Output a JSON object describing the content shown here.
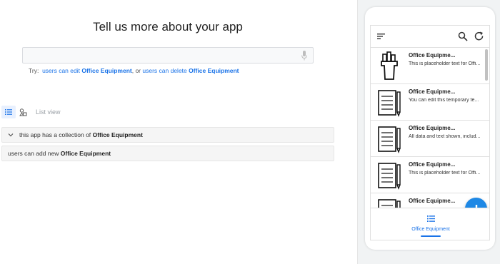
{
  "builder": {
    "heading": "Tell us more about your app",
    "input_value": "",
    "try": {
      "prefix": "Try:",
      "s1_text": "users can edit",
      "s1_entity": "Office Equipment",
      "sep": ", or",
      "s2_text": "users can delete",
      "s2_entity": "Office Equipment"
    },
    "view_label": "List view",
    "statements": [
      {
        "text": "this app has a collection of",
        "entity": "Office Equipment"
      },
      {
        "text": "users can add new",
        "entity": "Office Equipment"
      }
    ]
  },
  "preview": {
    "items": [
      {
        "title": "Office Equipme...",
        "desc": "This is placeholder text for Offi..."
      },
      {
        "title": "Office Equipme...",
        "desc": "You can edit this temporary te..."
      },
      {
        "title": "Office Equipme...",
        "desc": "All data and text shown, includ..."
      },
      {
        "title": "Office Equipme...",
        "desc": "This is placeholder text for Offi..."
      },
      {
        "title": "Office Equipme...",
        "desc": ""
      }
    ],
    "nav_label": "Office Equipment"
  },
  "colors": {
    "accent": "#1a73e8",
    "fab": "#1e88e5"
  },
  "icons": [
    "mic-icon",
    "list-view-icon",
    "component-view-icon",
    "chevron-down-icon",
    "menu-icon",
    "search-icon",
    "refresh-icon",
    "add-icon",
    "nav-list-icon"
  ]
}
